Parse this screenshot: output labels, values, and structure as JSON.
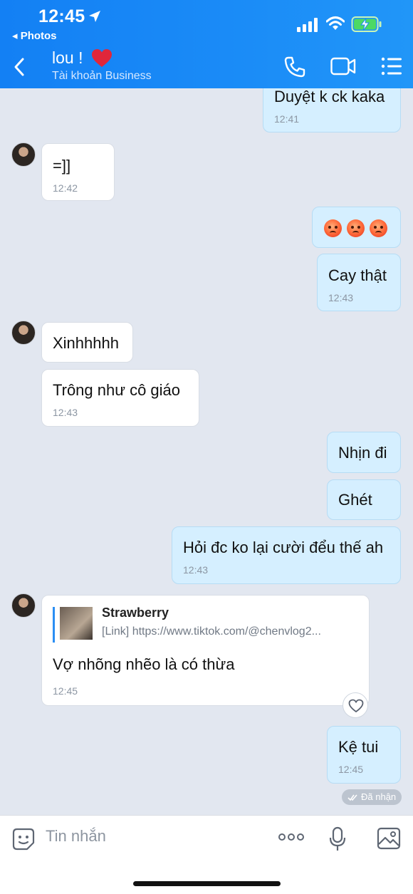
{
  "status_bar": {
    "time": "12:45",
    "back_app": "◂ Photos"
  },
  "header": {
    "contact_name": "lou !",
    "subtitle": "Tài khoản Business"
  },
  "messages": [
    {
      "text": "Duyệt k ck kaka",
      "time": "12:41"
    },
    {
      "text": "=]]",
      "time": "12:42"
    },
    {
      "text": "Cay thật",
      "time": "12:43"
    },
    {
      "text": "Xinhhhhh"
    },
    {
      "text": "Trông như cô giáo",
      "time": "12:43"
    },
    {
      "text": "Nhịn đi"
    },
    {
      "text": "Ghét"
    },
    {
      "text": "Hỏi đc ko lại cười đểu thế ah",
      "time": "12:43"
    },
    {
      "text": "Vợ nhõng nhẽo là có thừa",
      "time": "12:45",
      "quote_title": "Strawberry",
      "quote_link": "[Link] https://www.tiktok.com/@chenvlog2..."
    },
    {
      "text": "Kệ tui",
      "time": "12:45"
    }
  ],
  "seen_label": "Đã nhận",
  "input": {
    "placeholder": "Tin nhắn"
  },
  "colors": {
    "header": "#1a8bf7",
    "outgoing_bubble": "#d5efff",
    "incoming_bubble": "#ffffff",
    "chat_bg": "#e2e7f0"
  }
}
